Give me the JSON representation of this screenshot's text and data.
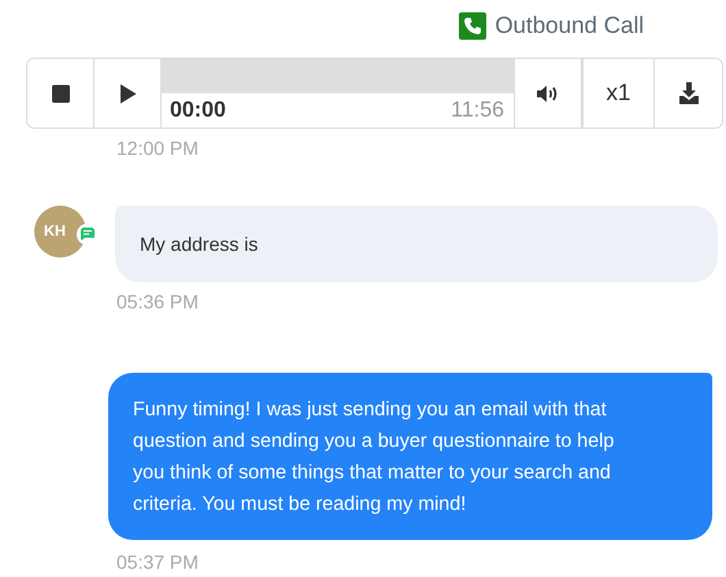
{
  "call_label": "Outbound Call",
  "player": {
    "current_time": "00:00",
    "duration": "11:56",
    "level": 0,
    "speed": "x1"
  },
  "call_time": "12:00 PM",
  "messages": [
    {
      "kind": "incoming",
      "initials": "KH",
      "text": "My address is",
      "time": "05:36 PM"
    },
    {
      "kind": "outgoing",
      "text": "Funny timing! I was just sending you an email with that question and sending you a buyer questionnaire to help you think of some things that matter to your search and criteria. You must be reading my mind!",
      "time": "05:37 PM"
    }
  ]
}
